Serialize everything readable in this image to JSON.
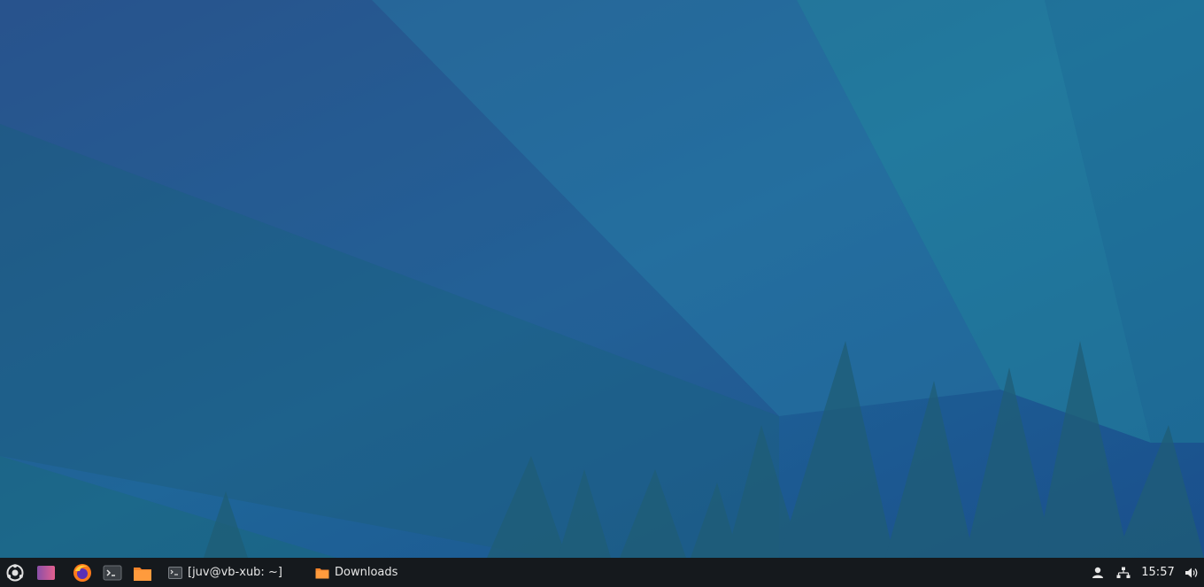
{
  "desktop": {
    "wallpaper": "xubuntu-aurora-forest",
    "colors": {
      "base": "#1f5d96",
      "beam": "#2a86a8",
      "trees": "#1e5a78"
    }
  },
  "taskbar": {
    "background": "#15191d",
    "whisker_menu": {
      "icon": "xubuntu-logo-icon"
    },
    "launchers": [
      {
        "name": "workspace-switcher",
        "icon": "workspace-icon"
      },
      {
        "name": "firefox",
        "icon": "firefox-icon"
      },
      {
        "name": "terminal",
        "icon": "terminal-icon"
      },
      {
        "name": "file-manager",
        "icon": "folder-icon"
      }
    ],
    "tasks": [
      {
        "label": "[juv@vb-xub: ~]",
        "icon": "terminal-icon"
      },
      {
        "label": "Downloads",
        "icon": "folder-icon"
      }
    ],
    "tray": {
      "user_icon": "user-icon",
      "network_icon": "network-icon",
      "clock": "15:57",
      "volume_icon": "volume-icon"
    }
  }
}
